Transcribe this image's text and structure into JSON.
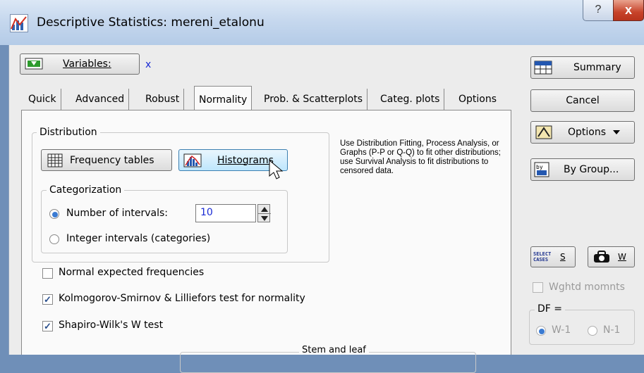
{
  "window": {
    "title": "Descriptive Statistics: mereni_etalonu",
    "help": "?",
    "close": "x"
  },
  "variables": {
    "button_label": "Variables:",
    "value": "x"
  },
  "tabs": [
    "Quick",
    "Advanced",
    "Robust",
    "Normality",
    "Prob. & Scatterplots",
    "Categ. plots",
    "Options"
  ],
  "active_tab": "Normality",
  "distribution": {
    "label": "Distribution",
    "frequency_tables": "Frequency tables",
    "histograms": "Histograms",
    "categorization": {
      "label": "Categorization",
      "number_of_intervals": "Number of intervals:",
      "intervals_value": "10",
      "integer_intervals": "Integer intervals (categories)"
    }
  },
  "checks": {
    "normal_expected": "Normal expected frequencies",
    "ks_test": "Kolmogorov-Smirnov & Lilliefors test for normality",
    "shapiro": "Shapiro-Wilk's W test"
  },
  "info_text": "Use Distribution Fitting, Process Analysis, or Graphs (P-P or Q-Q) to fit other distributions; use Survival Analysis to fit distributions to censored data.",
  "stem_leaf_label": "Stem and leaf",
  "right_panel": {
    "summary": "Summary",
    "cancel": "Cancel",
    "options": "Options",
    "by_group": "By Group...",
    "select_cases_icon": "SELECT CASES",
    "select_cases_letter": "S",
    "weights_letter": "W",
    "wghtd_momnts": "Wghtd momnts",
    "df_label": "DF =",
    "df_w1": "W-1",
    "df_n1": "N-1"
  }
}
